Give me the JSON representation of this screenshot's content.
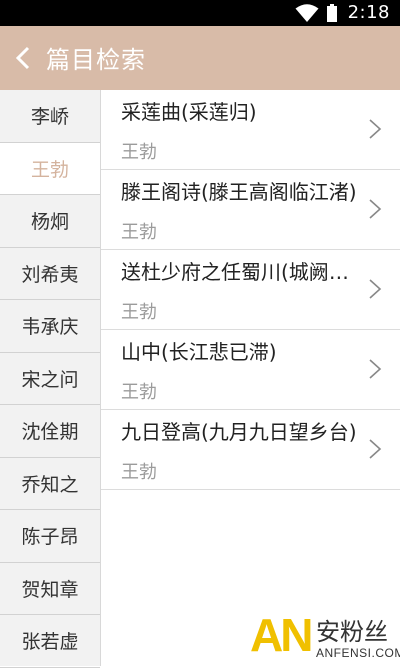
{
  "status_bar": {
    "time": "2:18",
    "icons": [
      "wifi-icon",
      "battery-icon"
    ]
  },
  "header": {
    "title": "篇目检索",
    "back_icon": "chevron-left-icon"
  },
  "sidebar": {
    "items": [
      {
        "label": "李峤",
        "active": false
      },
      {
        "label": "王勃",
        "active": true
      },
      {
        "label": "杨炯",
        "active": false
      },
      {
        "label": "刘希夷",
        "active": false
      },
      {
        "label": "韦承庆",
        "active": false
      },
      {
        "label": "宋之问",
        "active": false
      },
      {
        "label": "沈佺期",
        "active": false
      },
      {
        "label": "乔知之",
        "active": false
      },
      {
        "label": "陈子昂",
        "active": false
      },
      {
        "label": "贺知章",
        "active": false
      },
      {
        "label": "张若虚",
        "active": false
      }
    ]
  },
  "poems": [
    {
      "title": "采莲曲(采莲归)",
      "author": "王勃"
    },
    {
      "title": "滕王阁诗(滕王高阁临江渚)",
      "author": "王勃"
    },
    {
      "title": "送杜少府之任蜀川(城阙辅三秦)",
      "author": "王勃"
    },
    {
      "title": "山中(长江悲已滞)",
      "author": "王勃"
    },
    {
      "title": "九日登高(九月九日望乡台)",
      "author": "王勃"
    }
  ],
  "watermark": {
    "big": "AN",
    "cn": "安粉丝",
    "sub": "ANFENSI.COM"
  },
  "colors": {
    "header_bg": "#d8bba8",
    "active_text": "#d4b39e",
    "sidebar_bg": "#f2f2f2"
  }
}
